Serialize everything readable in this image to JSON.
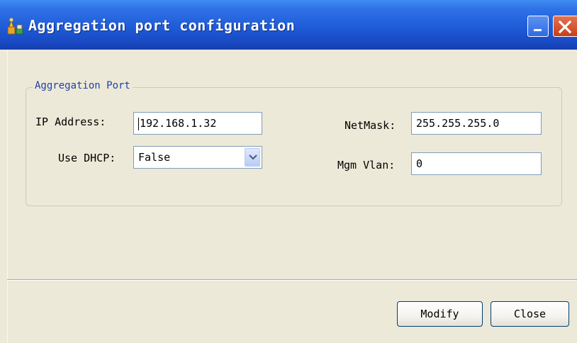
{
  "window": {
    "title": "Aggregation port configuration"
  },
  "group": {
    "legend": "Aggregation Port"
  },
  "fields": {
    "ip_label": "IP Address:",
    "ip_value": "192.168.1.32",
    "dhcp_label": "Use DHCP:",
    "dhcp_value": "False",
    "netmask_label": "NetMask:",
    "netmask_value": "255.255.255.0",
    "vlan_label": "Mgm Vlan:",
    "vlan_value": "0"
  },
  "buttons": {
    "modify": "Modify",
    "close": "Close"
  },
  "colors": {
    "title_bar": "#1f5bd8",
    "close_button": "#c93e17",
    "legend_text": "#2040a8",
    "window_bg": "#ece9d8"
  },
  "icons": {
    "app": "app-icon",
    "minimize": "minimize-icon",
    "close": "close-icon",
    "dropdown": "chevron-down-icon"
  }
}
